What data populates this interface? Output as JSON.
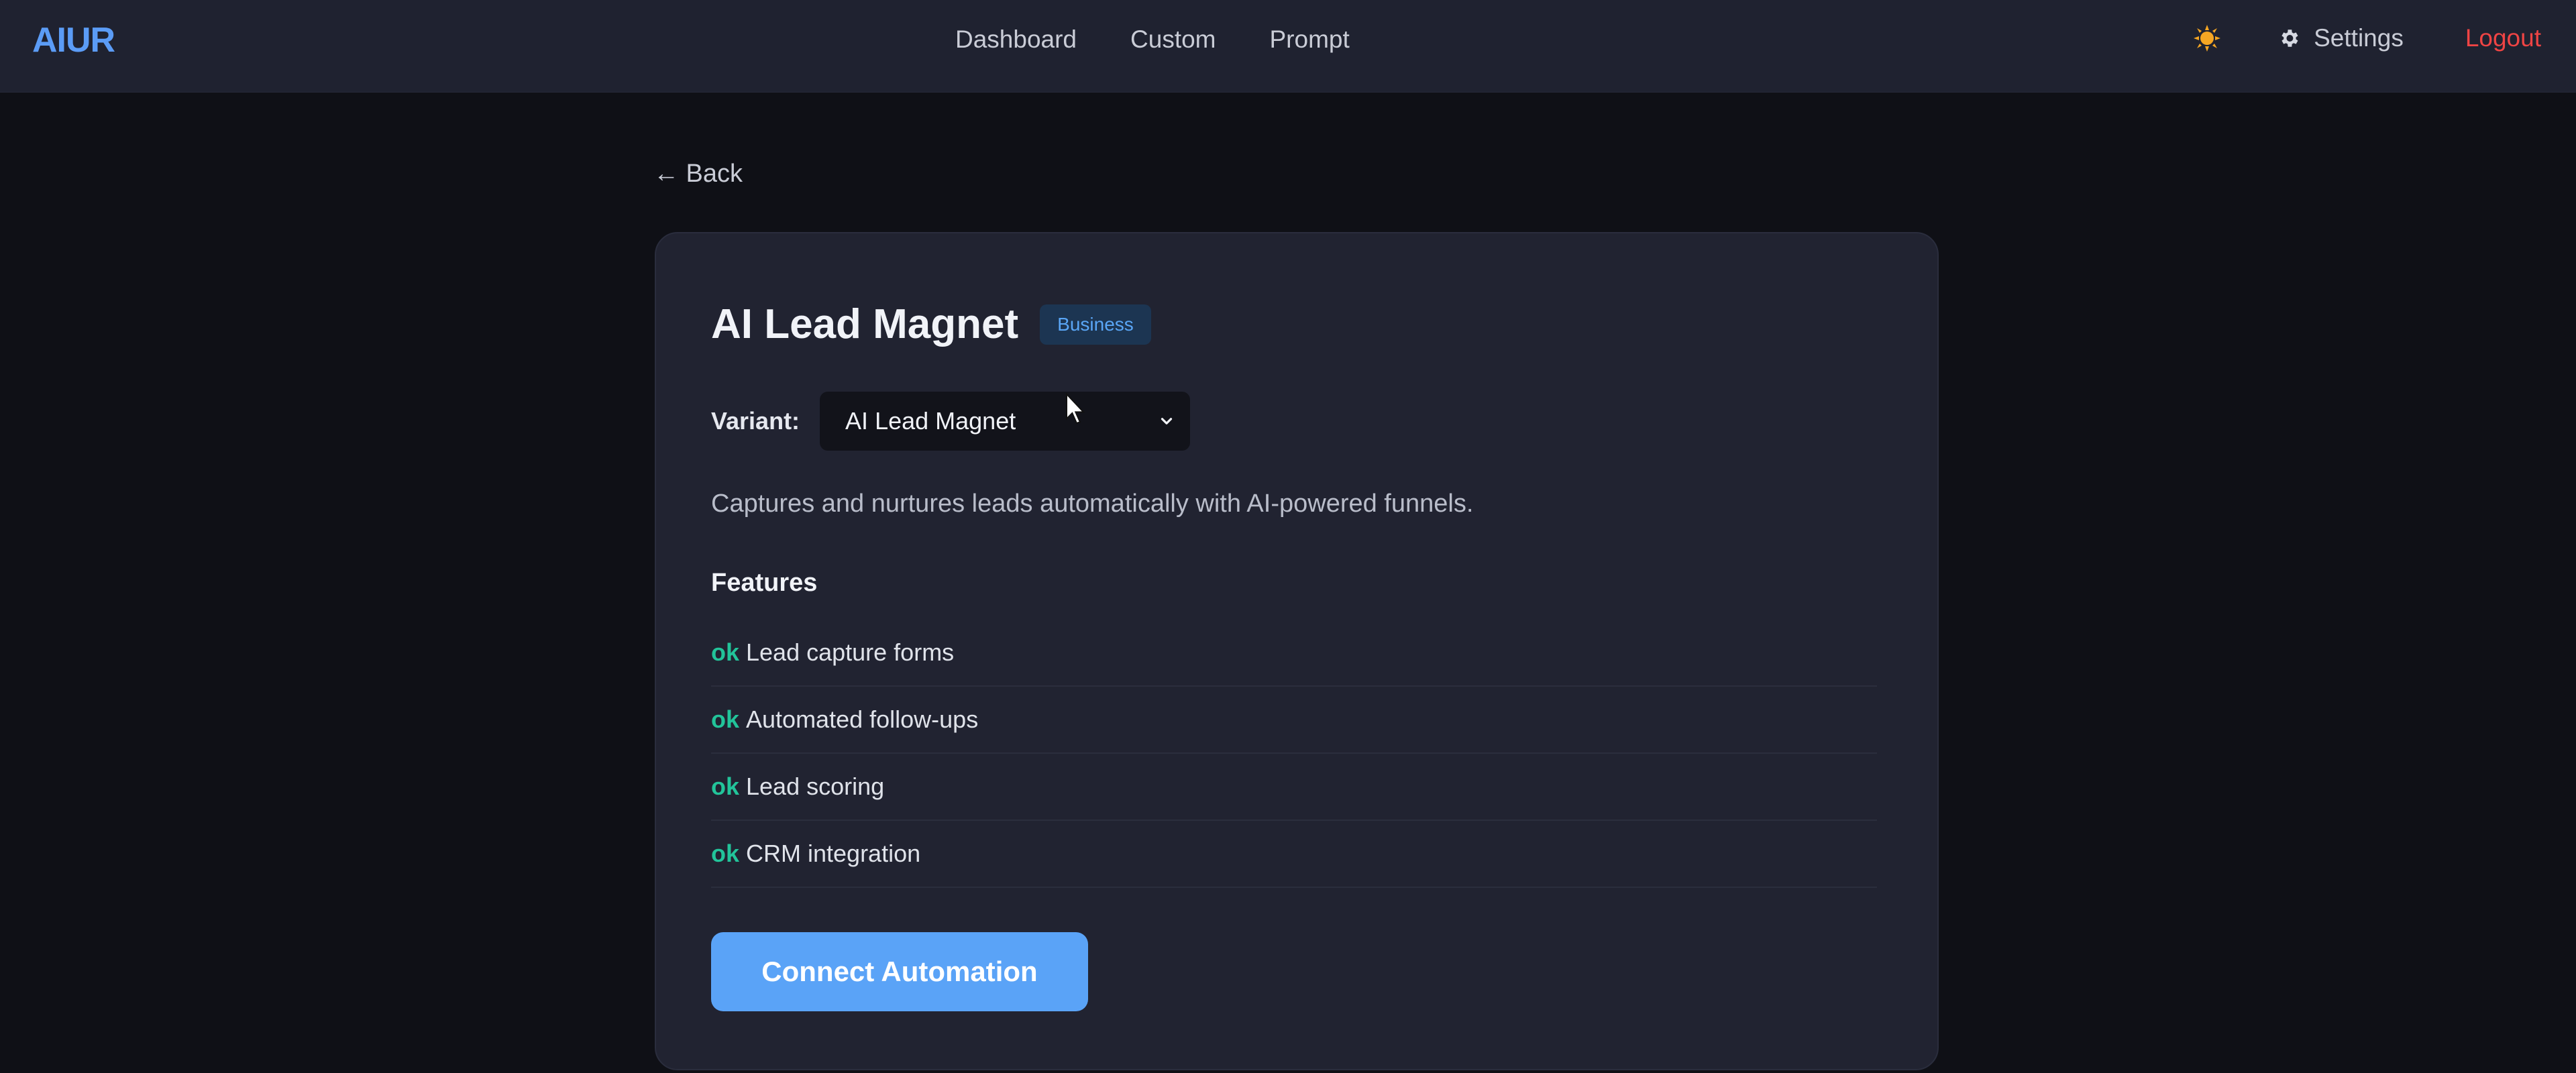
{
  "header": {
    "logo": "AIUR",
    "nav": [
      "Dashboard",
      "Custom",
      "Prompt"
    ],
    "theme_icon": "sun-icon",
    "settings_label": "Settings",
    "logout_label": "Logout"
  },
  "back_label": "← Back",
  "card": {
    "title": "AI Lead Magnet",
    "badge": "Business",
    "variant_label": "Variant:",
    "variant_value": "AI Lead Magnet",
    "description": "Captures and nurtures leads automatically with AI-powered funnels.",
    "features_title": "Features",
    "features": [
      {
        "status": "ok",
        "label": "Lead capture forms"
      },
      {
        "status": "ok",
        "label": "Automated follow-ups"
      },
      {
        "status": "ok",
        "label": "Lead scoring"
      },
      {
        "status": "ok",
        "label": "CRM integration"
      }
    ],
    "cta": "Connect Automation"
  },
  "colors": {
    "accent": "#5aa3f7",
    "logo": "#5b9cf6",
    "logout": "#ef4444",
    "ok": "#22c49a",
    "background": "#0f1016",
    "card": "#212331"
  }
}
